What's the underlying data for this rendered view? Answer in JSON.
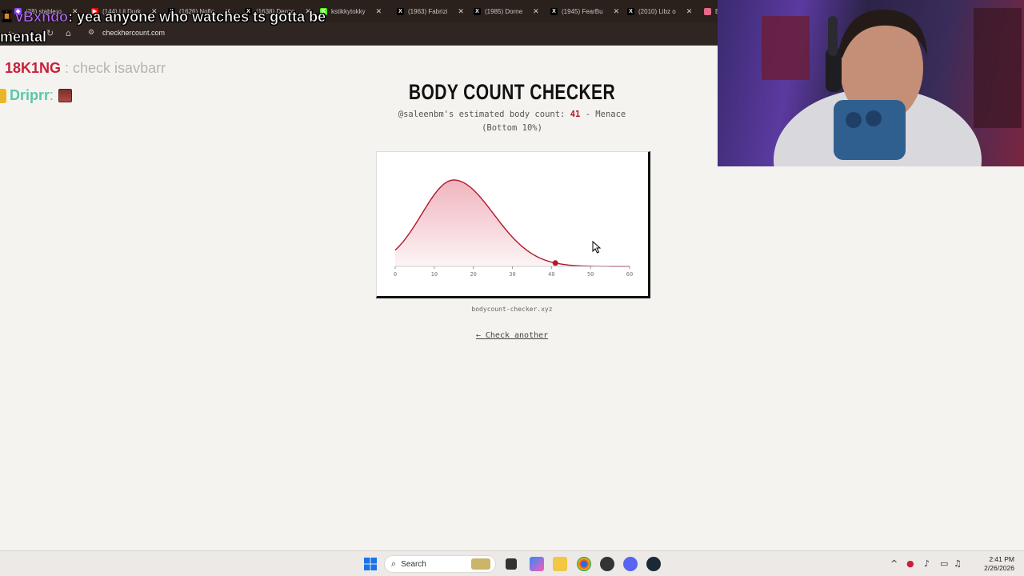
{
  "browser": {
    "tabs": [
      {
        "label": "(38) stablero",
        "fav_color": "#9147ff",
        "fav_glyph": "◆"
      },
      {
        "label": "(144) Lil Durk",
        "fav_color": "#ff0000",
        "fav_glyph": "▶"
      },
      {
        "label": "(1626) Nofla",
        "fav_color": "#000000",
        "fav_glyph": "X"
      },
      {
        "label": "(1638) Denzo",
        "fav_color": "#000000",
        "fav_glyph": "X"
      },
      {
        "label": "kstikkytokky",
        "fav_color": "#53fc18",
        "fav_glyph": "K"
      },
      {
        "label": "(1963) Fabrizi",
        "fav_color": "#000000",
        "fav_glyph": "X"
      },
      {
        "label": "(1985) Dorne",
        "fav_color": "#000000",
        "fav_glyph": "X"
      },
      {
        "label": "(1945) FearBu",
        "fav_color": "#000000",
        "fav_glyph": "X"
      },
      {
        "label": "(2010) Libz o",
        "fav_color": "#000000",
        "fav_glyph": "X"
      },
      {
        "label": "B",
        "fav_color": "#e66a8a",
        "fav_glyph": ""
      }
    ],
    "url": "checkhercount.com"
  },
  "chat": [
    {
      "user": "vBxndo",
      "message": ": yea anyone who watches ts gotta be mental",
      "user_color": "#b06cf0"
    },
    {
      "user": "18K1NG",
      "message": " : check isavbarr",
      "user_color": "#c8203a"
    },
    {
      "user": "Driprr",
      "message": " :",
      "user_color": "#5ac7a9"
    }
  ],
  "page": {
    "title": "BODY COUNT CHECKER",
    "summary_prefix": "@saleenbm's estimated body count: ",
    "count": "41",
    "summary_suffix": " - Menace",
    "percentile": "(Bottom 10%)",
    "domain": "bodycount-checker.xyz",
    "check_another": "← Check another"
  },
  "chart_data": {
    "type": "area",
    "x_ticks": [
      0,
      10,
      20,
      30,
      40,
      50,
      60
    ],
    "xlim": [
      0,
      60
    ],
    "curve": {
      "shape": "right-skewed bell",
      "peak_x": 15,
      "start_y_fraction": 0.27
    },
    "marker": {
      "x": 41
    },
    "colors": {
      "line": "#b3162a",
      "fill": "#eda7b1",
      "marker": "#b3162a"
    },
    "grid": false,
    "legend": "none"
  },
  "taskbar": {
    "search_placeholder": "Search",
    "time": "2:41 PM",
    "date": "2/26/2026"
  },
  "colors": {
    "accent": "#b3162a",
    "page_bg": "#f5f3ef",
    "chrome_bg": "#2a211d"
  }
}
